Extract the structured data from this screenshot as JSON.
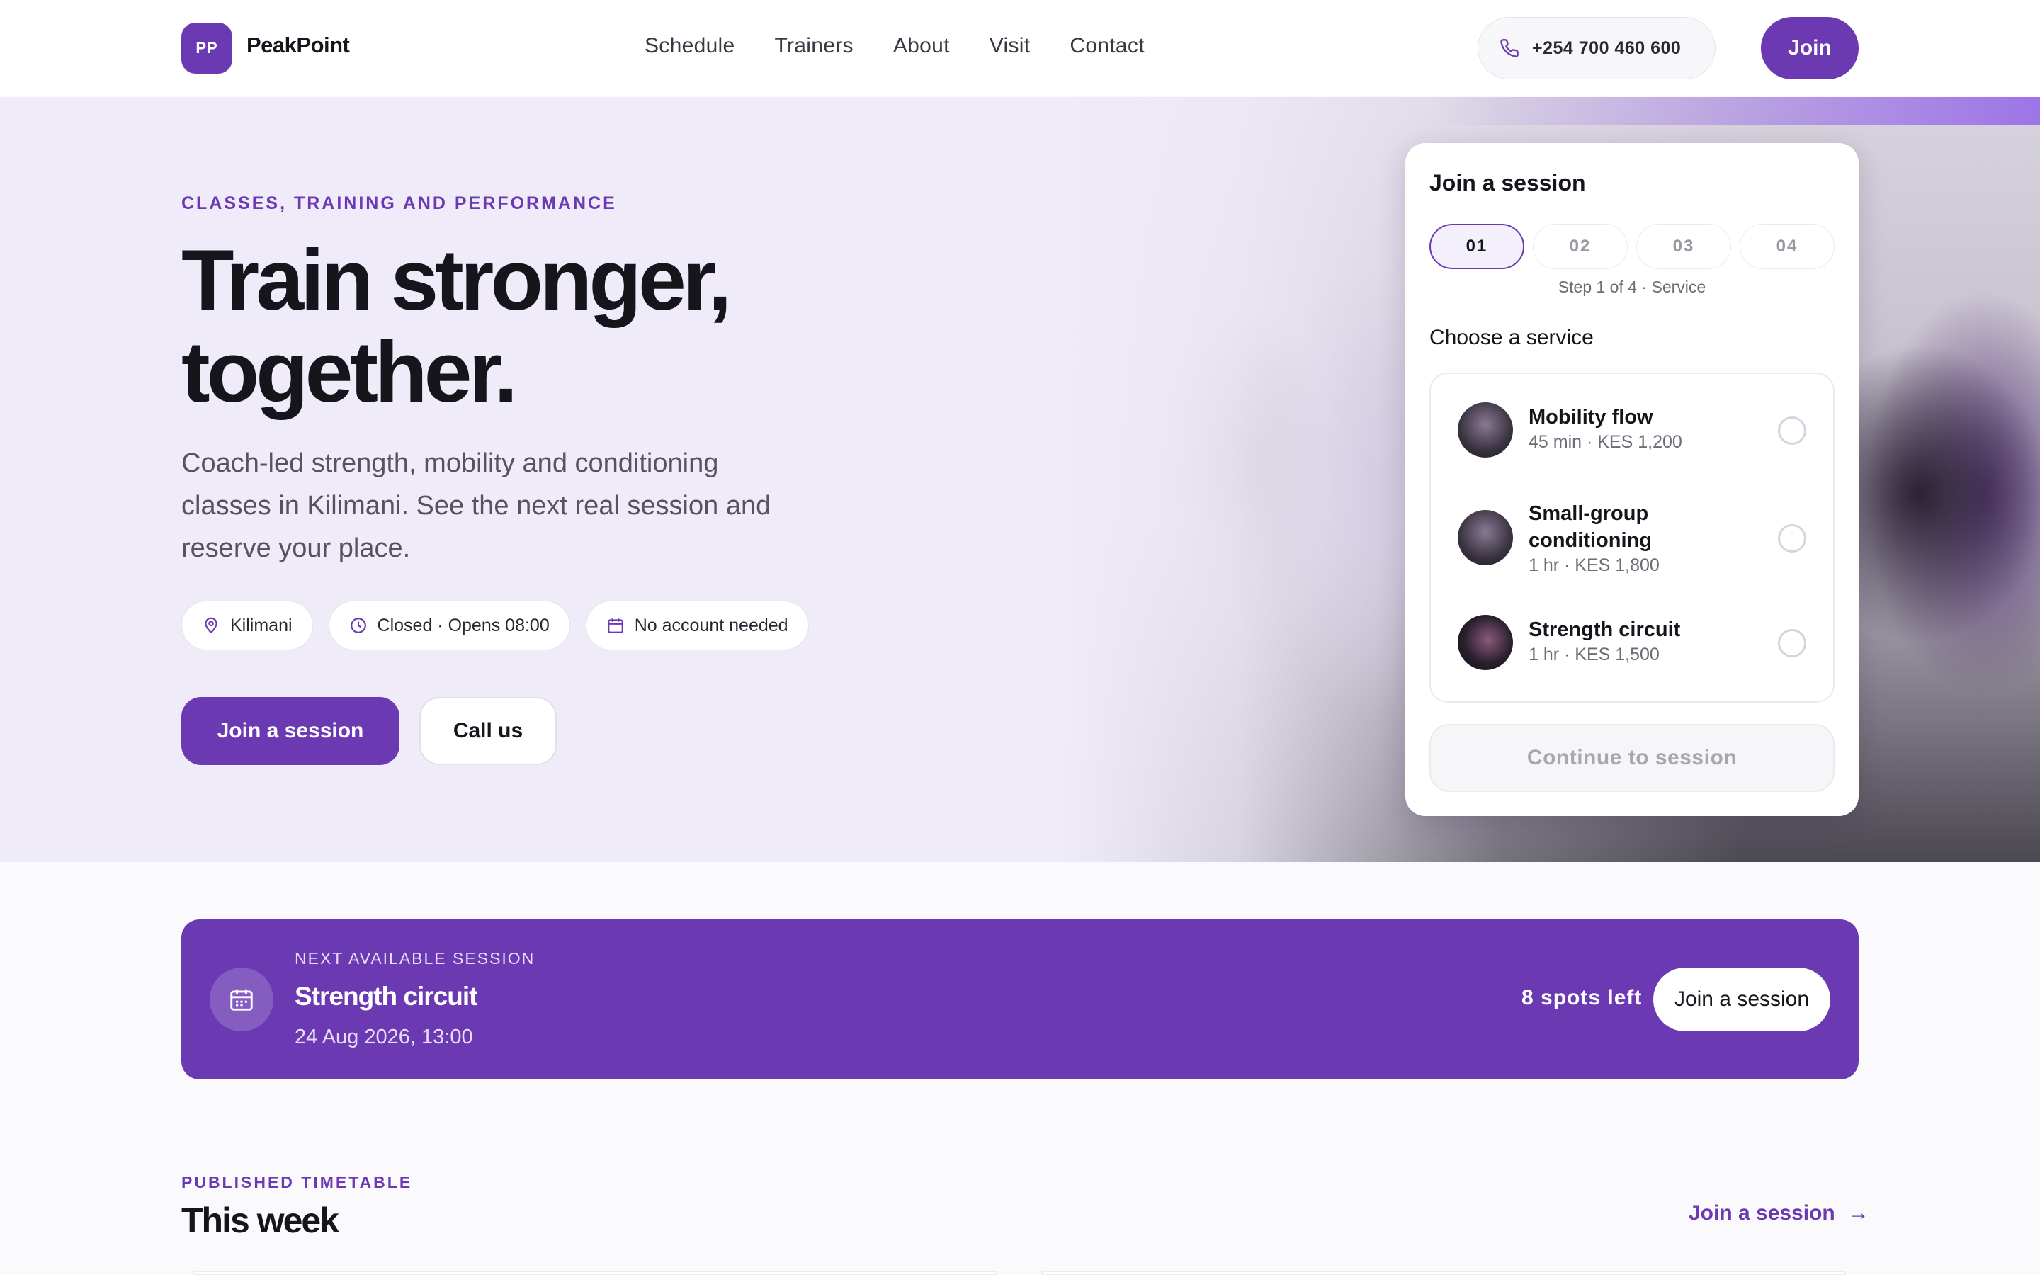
{
  "header": {
    "logo_initials": "PP",
    "brand": "PeakPoint",
    "nav": [
      "Schedule",
      "Trainers",
      "About",
      "Visit",
      "Contact"
    ],
    "phone": "+254 700 460 600",
    "join_label": "Join"
  },
  "hero": {
    "eyebrow": "CLASSES, TRAINING AND PERFORMANCE",
    "title_line1": "Train stronger,",
    "title_line2": "together.",
    "lead": "Coach-led strength, mobility and conditioning classes in Kilimani. See the next real session and reserve your place.",
    "chips": [
      {
        "icon": "map-pin-icon",
        "label": "Kilimani"
      },
      {
        "icon": "clock-icon",
        "label": "Closed · Opens 08:00"
      },
      {
        "icon": "calendar-icon",
        "label": "No account needed"
      }
    ],
    "cta_primary": "Join a session",
    "cta_secondary": "Call us"
  },
  "booking": {
    "title": "Join a session",
    "steps": [
      "01",
      "02",
      "03",
      "04"
    ],
    "active_step": 1,
    "step_caption": "Step 1 of 4 · Service",
    "choose_label": "Choose a service",
    "services": [
      {
        "name": "Mobility flow",
        "meta": "45 min · KES 1,200"
      },
      {
        "name": "Small-group conditioning",
        "meta": "1 hr · KES 1,800"
      },
      {
        "name": "Strength circuit",
        "meta": "1 hr · KES 1,500"
      }
    ],
    "continue_label": "Continue to session"
  },
  "next_session": {
    "eyebrow": "NEXT AVAILABLE SESSION",
    "title": "Strength circuit",
    "datetime": "24 Aug 2026, 13:00",
    "spots": "8 spots left",
    "button": "Join a session"
  },
  "timetable": {
    "eyebrow": "PUBLISHED TIMETABLE",
    "title": "This week",
    "link": "Join a session",
    "link_arrow": "→"
  },
  "colors": {
    "accent": "#6b3ab3",
    "hero_bg": "#efebf9",
    "text": "#17151c"
  }
}
